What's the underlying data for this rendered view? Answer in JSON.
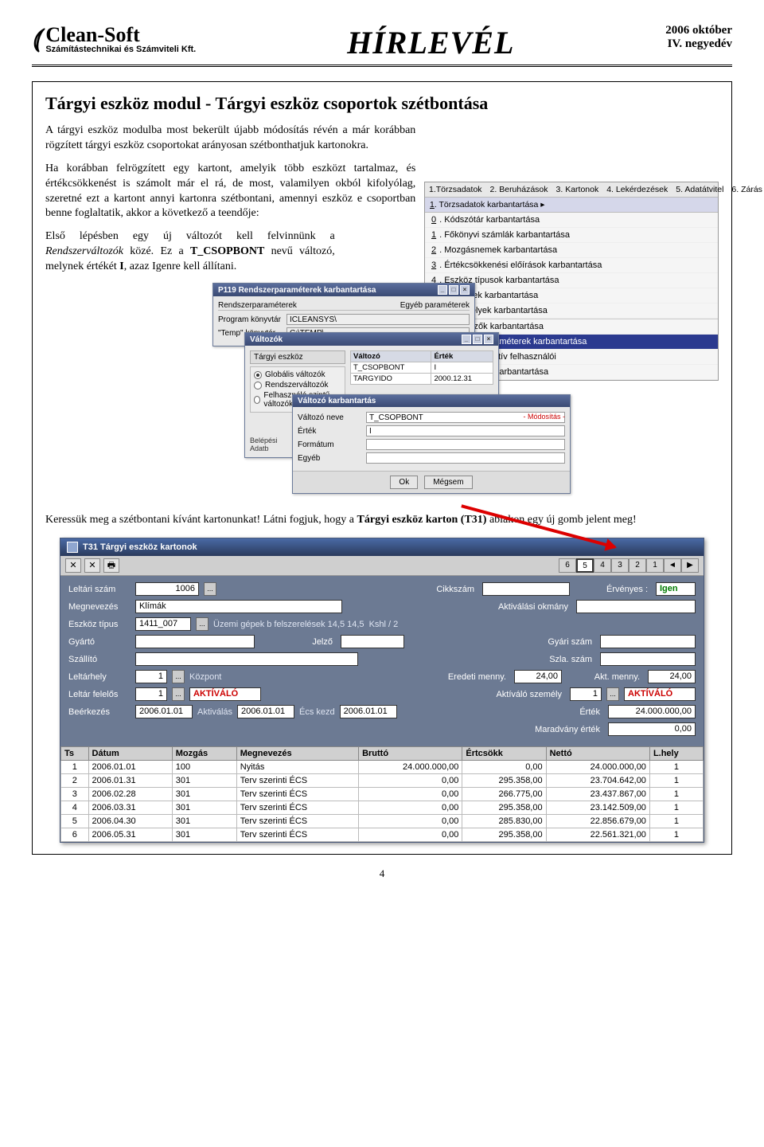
{
  "header": {
    "logo_name": "Clean-Soft",
    "logo_sub": "Számítástechnikai és Számviteli Kft.",
    "newsletter": "HÍRLEVÉL",
    "date_line1": "2006 október",
    "date_line2": "IV. negyedév"
  },
  "section": {
    "title": "Tárgyi eszköz modul - Tárgyi eszköz csoportok szétbontása",
    "p1": "A tárgyi eszköz modulba most bekerült újabb módosítás révén a már korábban rögzített tárgyi eszköz csoportokat arányosan szétbonthatjuk kartonokra.",
    "p2": "Ha korábban felrögzített egy kartont, amelyik több eszközt tartalmaz, és értékcsökkenést is számolt már el rá, de most, valamilyen okból kifolyólag, szeretné ezt a kartont annyi kartonra szétbontani, amennyi eszköz e csoportban benne foglaltatik, akkor a következő a teendője:",
    "p3a": "Első lépésben egy új változót kell felvinnünk a ",
    "p3b": "Rendszerváltozók",
    "p3c": " közé. Ez a ",
    "p3d": "T_CSOPBONT",
    "p3e": " nevű változó, melynek értékét ",
    "p3f": "I",
    "p3g": ", azaz Igenre kell állítani.",
    "bottom1": "Keressük meg a szétbontani kívánt kartonunkat! Látni fogjuk, hogy a ",
    "bottom2": "Tárgyi eszköz karton (T31)",
    "bottom3": " ablakon egy új gomb jelent meg!"
  },
  "menu": {
    "tabs": [
      "1.Törzsadatok",
      "2. Beruházások",
      "3. Kartonok",
      "4. Lekérdezések",
      "5. Adatátvitel",
      "6. Zárás"
    ],
    "sub": "1. Törzsadatok karbantartása",
    "items": [
      {
        "k": "0",
        "t": "Kódszótár karbantartása"
      },
      {
        "k": "1",
        "t": "Főkönyvi számlák karbantartása"
      },
      {
        "k": "2",
        "t": "Mozgásnemek karbantartása"
      },
      {
        "k": "3",
        "t": "Értékcsökkenési előírások karbantartása"
      },
      {
        "k": "4",
        "t": "Eszköz típusok karbantartása"
      },
      {
        "k": "5",
        "t": "Partnerek karbantartása"
      },
      {
        "k": "6",
        "t": "Leltárhelyek karbantartása"
      },
      {
        "k": "8",
        "t": "Ügyintézők karbantartása",
        "sep": true
      },
      {
        "k": "9",
        "t": "Rendszerparaméterek karbantartása",
        "hl": true
      },
      {
        "k": "A",
        "t": "A rendszer aktív felhasználói"
      },
      {
        "k": "B",
        "t": "Adatbázisok karbantartása"
      }
    ]
  },
  "p119": {
    "title": "P119 Rendszerparaméterek karbantartása",
    "grp_title": "Rendszerparaméterek",
    "lbl_progdir": "Program könyvtár",
    "val_progdir": "ICLEANSYS\\",
    "lbl_tempdir": "\"Temp\" könyvtár",
    "val_tempdir": "C:\\TEMP\\",
    "tab": "Egyéb paraméterek"
  },
  "valtozok": {
    "title": "Változók",
    "tab": "Tárgyi eszköz",
    "radios": [
      "Globális változók",
      "Rendszerváltozók",
      "Felhasználó szintű változók"
    ],
    "cols": [
      "Változó",
      "Érték"
    ],
    "rows": [
      {
        "v": "T_CSOPBONT",
        "e": "I"
      },
      {
        "v": "TARGYIDO",
        "e": "2000.12.31"
      }
    ],
    "side_labels": [
      "Belépési",
      "Adatb"
    ]
  },
  "valtozo_karb": {
    "title": "Változó karbantartás",
    "mode": "- Módosítás -",
    "lbl_name": "Változó neve",
    "val_name": "T_CSOPBONT",
    "lbl_val": "Érték",
    "val_val": "I",
    "lbl_fmt": "Formátum",
    "lbl_other": "Egyéb",
    "ok": "Ok",
    "cancel": "Mégsem"
  },
  "t31": {
    "title": "T31 Tárgyi eszköz kartonok",
    "tools": [
      "✕",
      "✕",
      "🖶"
    ],
    "pager": [
      "6",
      "5",
      "4",
      "3",
      "2",
      "1",
      "◄",
      "▶"
    ],
    "pager_active_idx": 1,
    "labels": {
      "leltari": "Leltári szám",
      "cikkszam": "Cikkszám",
      "ervenyes": "Érvényes :",
      "megnevezes": "Megnevezés",
      "aktokm": "Aktiválási okmány",
      "eszkoztipus": "Eszköz típus",
      "kshl": "Kshl / 2",
      "gyarto": "Gyártó",
      "jelzo": "Jelző",
      "gyariszam": "Gyári szám",
      "szallito": "Szállító",
      "szlaszam": "Szla. szám",
      "leltarhely": "Leltárhely",
      "eredetim": "Eredeti menny.",
      "aktm": "Akt. menny.",
      "leltarf": "Leltár felelős",
      "aktszemely": "Aktíváló személy",
      "beerkezes": "Beérkezés",
      "aktivalas": "Aktiválás",
      "ecskezd": "Écs kezd",
      "ertek": "Érték",
      "maradvany": "Maradvány érték"
    },
    "values": {
      "leltari": "1006",
      "ervenyes": "Igen",
      "megnevezes": "Klímák",
      "eszkoztipus": "1411_007",
      "eszkoztipus_desc": "Üzemi gépek b felszerelések 14,5 14,5",
      "leltarhely": "1",
      "leltarhely_desc": "Központ",
      "eredetim": "24,00",
      "aktm": "24,00",
      "leltarf": "1",
      "leltarf_desc": "AKTÍVÁLÓ",
      "aktszemely": "1",
      "aktszemely_desc": "AKTÍVÁLÓ",
      "beerkezes": "2006.01.01",
      "aktivalas": "2006.01.01",
      "ecskezd": "2006.01.01",
      "ertek": "24.000.000,00",
      "maradvany": "0,00"
    },
    "grid_cols": [
      "Ts",
      "Dátum",
      "Mozgás",
      "Megnevezés",
      "Bruttó",
      "Értcsökk",
      "Nettó",
      "L.hely"
    ],
    "grid_rows": [
      {
        "ts": "1",
        "d": "2006.01.01",
        "m": "100",
        "meg": "Nyitás",
        "b": "24.000.000,00",
        "e": "0,00",
        "n": "24.000.000,00",
        "l": "1"
      },
      {
        "ts": "2",
        "d": "2006.01.31",
        "m": "301",
        "meg": "Terv szerinti ÉCS",
        "b": "0,00",
        "e": "295.358,00",
        "n": "23.704.642,00",
        "l": "1"
      },
      {
        "ts": "3",
        "d": "2006.02.28",
        "m": "301",
        "meg": "Terv szerinti ÉCS",
        "b": "0,00",
        "e": "266.775,00",
        "n": "23.437.867,00",
        "l": "1"
      },
      {
        "ts": "4",
        "d": "2006.03.31",
        "m": "301",
        "meg": "Terv szerinti ÉCS",
        "b": "0,00",
        "e": "295.358,00",
        "n": "23.142.509,00",
        "l": "1"
      },
      {
        "ts": "5",
        "d": "2006.04.30",
        "m": "301",
        "meg": "Terv szerinti ÉCS",
        "b": "0,00",
        "e": "285.830,00",
        "n": "22.856.679,00",
        "l": "1"
      },
      {
        "ts": "6",
        "d": "2006.05.31",
        "m": "301",
        "meg": "Terv szerinti ÉCS",
        "b": "0,00",
        "e": "295.358,00",
        "n": "22.561.321,00",
        "l": "1"
      }
    ]
  },
  "page_num": "4"
}
